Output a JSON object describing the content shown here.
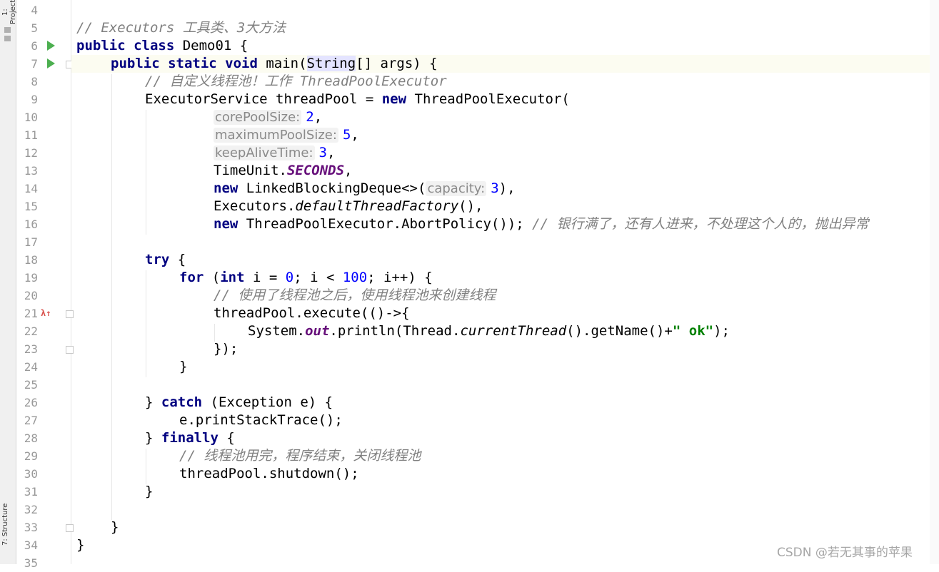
{
  "tool_windows": {
    "project_tab": "1: Project",
    "structure_tab": "7: Structure"
  },
  "gutter": {
    "line_numbers": [
      "4",
      "5",
      "6",
      "7",
      "8",
      "9",
      "10",
      "11",
      "12",
      "13",
      "14",
      "15",
      "16",
      "17",
      "18",
      "19",
      "20",
      "21",
      "22",
      "23",
      "24",
      "25",
      "26",
      "27",
      "28",
      "29",
      "30",
      "31",
      "32",
      "33",
      "34",
      "35"
    ]
  },
  "editor": {
    "lines": [
      {
        "no": "4",
        "indent": 0,
        "tokens": []
      },
      {
        "no": "5",
        "indent": 0,
        "tokens": [
          {
            "c": "cm",
            "t": "// Executors 工具类、3大方法"
          }
        ]
      },
      {
        "no": "6",
        "indent": 0,
        "tokens": [
          {
            "c": "kw",
            "t": "public class "
          },
          {
            "c": "",
            "t": "Demo01 {"
          }
        ]
      },
      {
        "no": "7",
        "indent": 1,
        "tokens": [
          {
            "c": "kw",
            "t": "public static void "
          },
          {
            "c": "",
            "t": "main("
          },
          {
            "c": "sel",
            "t": "String"
          },
          {
            "c": "",
            "t": "[] args) {"
          }
        ]
      },
      {
        "no": "8",
        "indent": 2,
        "tokens": [
          {
            "c": "cm",
            "t": "// 自定义线程池！工作 ThreadPoolExecutor"
          }
        ]
      },
      {
        "no": "9",
        "indent": 2,
        "tokens": [
          {
            "c": "",
            "t": "ExecutorService threadPool = "
          },
          {
            "c": "kw",
            "t": "new "
          },
          {
            "c": "",
            "t": "ThreadPoolExecutor("
          }
        ]
      },
      {
        "no": "10",
        "indent": 4,
        "tokens": [
          {
            "c": "hint",
            "t": "corePoolSize:"
          },
          {
            "c": "num",
            "t": "2"
          },
          {
            "c": "",
            "t": ","
          }
        ]
      },
      {
        "no": "11",
        "indent": 4,
        "tokens": [
          {
            "c": "hint",
            "t": "maximumPoolSize:"
          },
          {
            "c": "num",
            "t": "5"
          },
          {
            "c": "",
            "t": ","
          }
        ]
      },
      {
        "no": "12",
        "indent": 4,
        "tokens": [
          {
            "c": "hint",
            "t": "keepAliveTime:"
          },
          {
            "c": "num",
            "t": "3"
          },
          {
            "c": "",
            "t": ","
          }
        ]
      },
      {
        "no": "13",
        "indent": 4,
        "tokens": [
          {
            "c": "",
            "t": "TimeUnit."
          },
          {
            "c": "static-field",
            "t": "SECONDS"
          },
          {
            "c": "",
            "t": ","
          }
        ]
      },
      {
        "no": "14",
        "indent": 4,
        "tokens": [
          {
            "c": "kw",
            "t": "new "
          },
          {
            "c": "",
            "t": "LinkedBlockingDeque<>("
          },
          {
            "c": "hint",
            "t": "capacity:"
          },
          {
            "c": "num",
            "t": "3"
          },
          {
            "c": "",
            "t": "),"
          }
        ]
      },
      {
        "no": "15",
        "indent": 4,
        "tokens": [
          {
            "c": "",
            "t": "Executors."
          },
          {
            "c": "static-call",
            "t": "defaultThreadFactory"
          },
          {
            "c": "",
            "t": "(),"
          }
        ]
      },
      {
        "no": "16",
        "indent": 4,
        "tokens": [
          {
            "c": "kw",
            "t": "new "
          },
          {
            "c": "",
            "t": "ThreadPoolExecutor.AbortPolicy()); "
          },
          {
            "c": "cm",
            "t": "// 银行满了，还有人进来，不处理这个人的，抛出异常"
          }
        ]
      },
      {
        "no": "17",
        "indent": 0,
        "tokens": []
      },
      {
        "no": "18",
        "indent": 2,
        "tokens": [
          {
            "c": "kw",
            "t": "try "
          },
          {
            "c": "",
            "t": "{"
          }
        ]
      },
      {
        "no": "19",
        "indent": 3,
        "tokens": [
          {
            "c": "kw",
            "t": "for "
          },
          {
            "c": "",
            "t": "("
          },
          {
            "c": "kw",
            "t": "int "
          },
          {
            "c": "",
            "t": "i = "
          },
          {
            "c": "num",
            "t": "0"
          },
          {
            "c": "",
            "t": "; i < "
          },
          {
            "c": "num",
            "t": "100"
          },
          {
            "c": "",
            "t": "; i++) {"
          }
        ]
      },
      {
        "no": "20",
        "indent": 4,
        "tokens": [
          {
            "c": "cm",
            "t": "// 使用了线程池之后，使用线程池来创建线程"
          }
        ]
      },
      {
        "no": "21",
        "indent": 4,
        "tokens": [
          {
            "c": "",
            "t": "threadPool.execute(()->{"
          }
        ]
      },
      {
        "no": "22",
        "indent": 5,
        "tokens": [
          {
            "c": "",
            "t": "System."
          },
          {
            "c": "static-field",
            "t": "out"
          },
          {
            "c": "",
            "t": ".println(Thread."
          },
          {
            "c": "static-call",
            "t": "currentThread"
          },
          {
            "c": "",
            "t": "().getName()+"
          },
          {
            "c": "str",
            "t": "\" ok\""
          },
          {
            "c": "",
            "t": ");"
          }
        ]
      },
      {
        "no": "23",
        "indent": 4,
        "tokens": [
          {
            "c": "",
            "t": "});"
          }
        ]
      },
      {
        "no": "24",
        "indent": 3,
        "tokens": [
          {
            "c": "",
            "t": "}"
          }
        ]
      },
      {
        "no": "25",
        "indent": 0,
        "tokens": []
      },
      {
        "no": "26",
        "indent": 2,
        "tokens": [
          {
            "c": "",
            "t": "} "
          },
          {
            "c": "kw",
            "t": "catch "
          },
          {
            "c": "",
            "t": "(Exception e) {"
          }
        ]
      },
      {
        "no": "27",
        "indent": 3,
        "tokens": [
          {
            "c": "",
            "t": "e.printStackTrace();"
          }
        ]
      },
      {
        "no": "28",
        "indent": 2,
        "tokens": [
          {
            "c": "",
            "t": "} "
          },
          {
            "c": "kw",
            "t": "finally "
          },
          {
            "c": "",
            "t": "{"
          }
        ]
      },
      {
        "no": "29",
        "indent": 3,
        "tokens": [
          {
            "c": "cm",
            "t": "// 线程池用完，程序结束，关闭线程池"
          }
        ]
      },
      {
        "no": "30",
        "indent": 3,
        "tokens": [
          {
            "c": "",
            "t": "threadPool.shutdown();"
          }
        ]
      },
      {
        "no": "31",
        "indent": 2,
        "tokens": [
          {
            "c": "",
            "t": "}"
          }
        ]
      },
      {
        "no": "32",
        "indent": 0,
        "tokens": []
      },
      {
        "no": "33",
        "indent": 1,
        "tokens": [
          {
            "c": "",
            "t": "}"
          }
        ]
      },
      {
        "no": "34",
        "indent": 0,
        "tokens": [
          {
            "c": "",
            "t": "}"
          }
        ]
      },
      {
        "no": "35",
        "indent": 0,
        "tokens": []
      }
    ]
  },
  "colors": {
    "keyword": "#000080",
    "comment": "#808080",
    "number": "#0000ff",
    "string": "#008000",
    "static_field": "#660e7a",
    "run_icon": "#4caf50",
    "override_icon": "#d9534f"
  },
  "icons": {
    "run": "run-gutter-icon",
    "fold": "fold-marker-icon",
    "override": "implements-method-icon"
  },
  "watermark": "CSDN @若无其事的苹果"
}
